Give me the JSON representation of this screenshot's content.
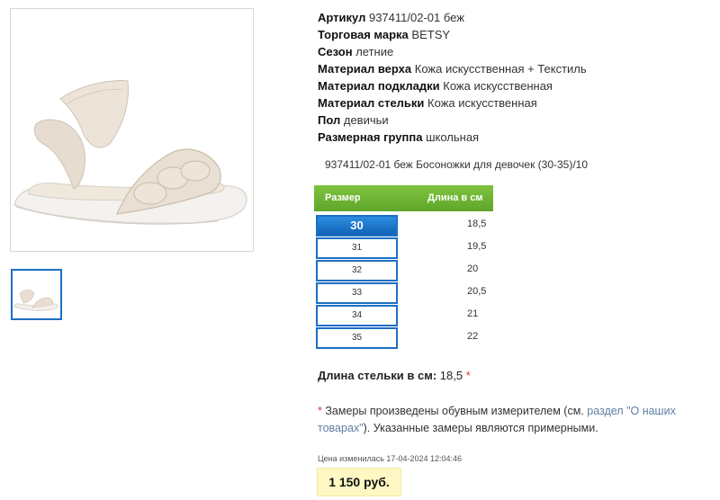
{
  "specs": [
    {
      "key": "Артикул",
      "value": "937411/02-01 беж"
    },
    {
      "key": "Торговая марка",
      "value": "BETSY"
    },
    {
      "key": "Сезон",
      "value": "летние"
    },
    {
      "key": "Материал верха",
      "value": "Кожа искусственная + Текстиль"
    },
    {
      "key": "Материал подкладки",
      "value": "Кожа искусственная"
    },
    {
      "key": "Материал стельки",
      "value": "Кожа искусственная"
    },
    {
      "key": "Пол",
      "value": "девичьи"
    },
    {
      "key": "Размерная группа",
      "value": "школьная"
    }
  ],
  "product_line": "937411/02-01 беж Босоножки для девочек (30-35)/10",
  "size_table": {
    "header_size": "Размер",
    "header_length": "Длина в см",
    "rows": [
      {
        "size": "30",
        "length": "18,5",
        "selected": true
      },
      {
        "size": "31",
        "length": "19,5",
        "selected": false
      },
      {
        "size": "32",
        "length": "20",
        "selected": false
      },
      {
        "size": "33",
        "length": "20,5",
        "selected": false
      },
      {
        "size": "34",
        "length": "21",
        "selected": false
      },
      {
        "size": "35",
        "length": "22",
        "selected": false
      }
    ]
  },
  "insole": {
    "label": "Длина стельки в см:",
    "value": "18,5",
    "star": "*"
  },
  "note": {
    "star": "*",
    "text_before": "Замеры произведены обувным измерителем (см. ",
    "link": "раздел \"О наших товарах\"",
    "text_after": "). Указанные замеры являются примерными."
  },
  "price": {
    "changed_label": "Цена изменилась 17-04-2024 12:04:46",
    "value": "1 150 руб."
  },
  "colors": {
    "accent_blue": "#1d6fc4",
    "header_green": "#6db534",
    "price_bg": "#fff8c4",
    "asterisk_red": "#e53935"
  }
}
